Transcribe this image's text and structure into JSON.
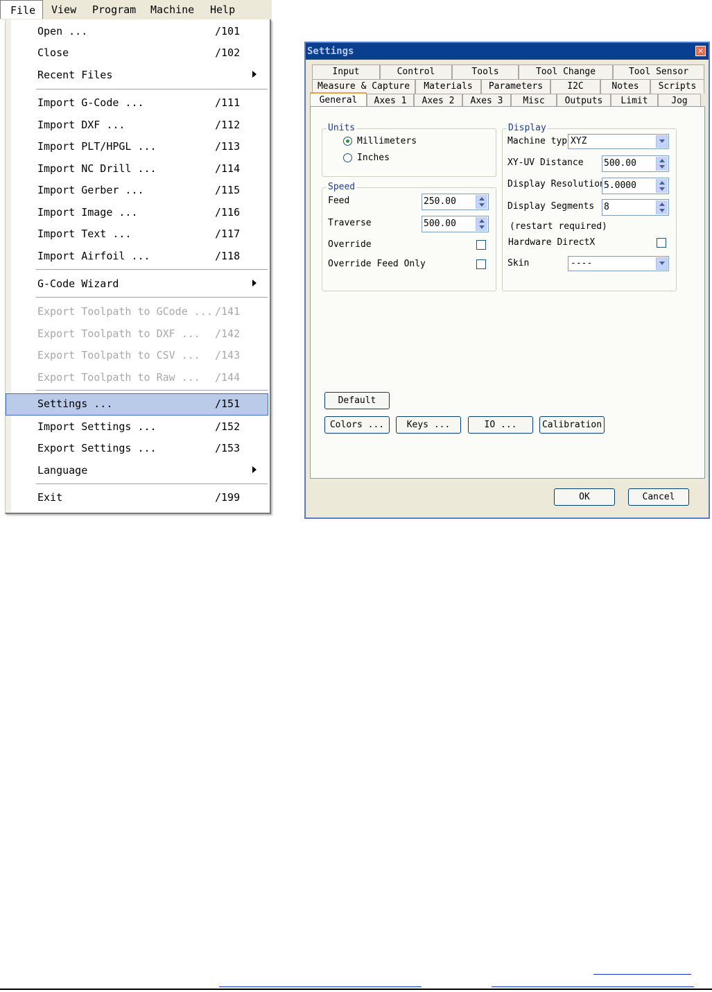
{
  "menubar": {
    "items": [
      "File",
      "View",
      "Program",
      "Machine",
      "Help"
    ]
  },
  "file_menu": {
    "items": [
      {
        "label": "Open ...",
        "shortcut": "/101"
      },
      {
        "label": "Close",
        "shortcut": "/102"
      },
      {
        "label": "Recent Files",
        "shortcut": ""
      },
      {
        "label": "Import G-Code ...",
        "shortcut": "/111"
      },
      {
        "label": "Import DXF ...",
        "shortcut": "/112"
      },
      {
        "label": "Import PLT/HPGL ...",
        "shortcut": "/113"
      },
      {
        "label": "Import NC Drill ...",
        "shortcut": "/114"
      },
      {
        "label": "Import Gerber ...",
        "shortcut": "/115"
      },
      {
        "label": "Import Image ...",
        "shortcut": "/116"
      },
      {
        "label": "Import Text ...",
        "shortcut": "/117"
      },
      {
        "label": "Import Airfoil ...",
        "shortcut": "/118"
      },
      {
        "label": "G-Code Wizard",
        "shortcut": ""
      },
      {
        "label": "Export Toolpath to GCode ...",
        "shortcut": "/141"
      },
      {
        "label": "Export Toolpath to DXF ...",
        "shortcut": "/142"
      },
      {
        "label": "Export Toolpath to CSV ...",
        "shortcut": "/143"
      },
      {
        "label": "Export Toolpath to Raw ...",
        "shortcut": "/144"
      },
      {
        "label": "Settings ...",
        "shortcut": "/151"
      },
      {
        "label": "Import Settings ...",
        "shortcut": "/152"
      },
      {
        "label": "Export Settings ...",
        "shortcut": "/153"
      },
      {
        "label": "Language",
        "shortcut": ""
      },
      {
        "label": "Exit",
        "shortcut": "/199"
      }
    ]
  },
  "dialog": {
    "title": "Settings",
    "close_glyph": "✕",
    "tabs_row1": [
      "Input",
      "Control",
      "Tools",
      "Tool Change",
      "Tool Sensor"
    ],
    "tabs_row2": [
      "Measure & Capture",
      "Materials",
      "Parameters",
      "I2C",
      "Notes",
      "Scripts"
    ],
    "tabs_row3": [
      "General",
      "Axes 1",
      "Axes 2",
      "Axes 3",
      "Misc",
      "Outputs",
      "Limit",
      "Jog"
    ],
    "units": {
      "title": "Units",
      "millimeters": "Millimeters",
      "inches": "Inches",
      "selected": "Millimeters"
    },
    "speed": {
      "title": "Speed",
      "feed_label": "Feed",
      "feed_value": "250.00",
      "traverse_label": "Traverse",
      "traverse_value": "500.00",
      "override_label": "Override",
      "override_checked": false,
      "override_feed_only_label": "Override Feed Only",
      "override_feed_only_checked": false
    },
    "display": {
      "title": "Display",
      "machine_type_label": "Machine type",
      "machine_type_value": "XYZ",
      "xyuv_label": "XY-UV Distance",
      "xyuv_value": "500.00",
      "resolution_label": "Display Resolution",
      "resolution_value": "5.0000",
      "segments_label": "Display Segments",
      "segments_value": "8",
      "restart_note": "(restart required)",
      "directx_label": "Hardware DirectX",
      "directx_checked": false,
      "skin_label": "Skin",
      "skin_value": "----"
    },
    "buttons": {
      "default": "Default",
      "colors": "Colors ...",
      "keys": "Keys ...",
      "io": "IO ...",
      "calibration": "Calibration",
      "ok": "OK",
      "cancel": "Cancel"
    }
  }
}
